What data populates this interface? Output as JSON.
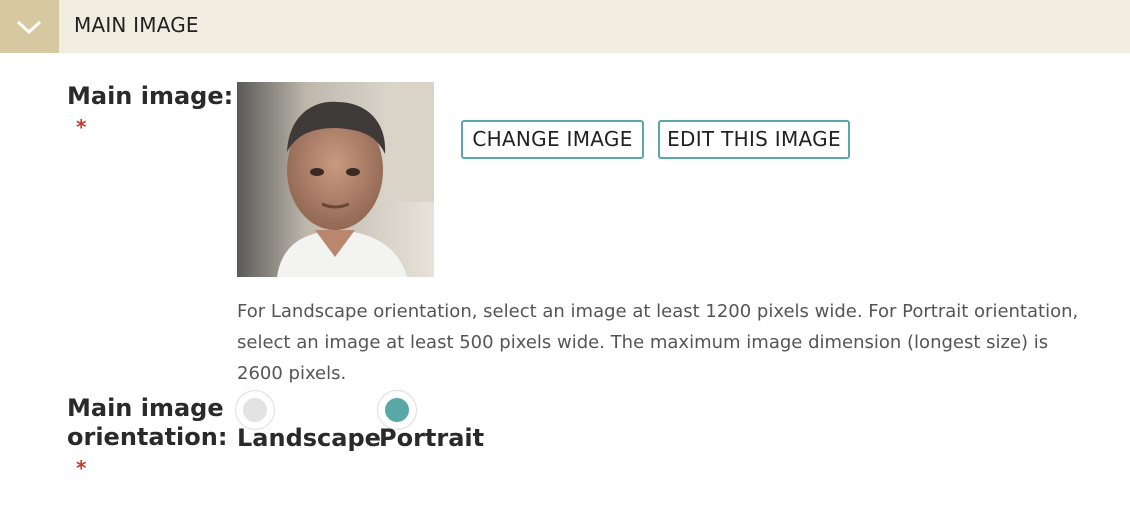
{
  "header": {
    "title": "MAIN IMAGE",
    "toggle_icon": "chevron-down-icon",
    "accent": "#d6c9a2",
    "background": "#f1ede1"
  },
  "main_image": {
    "label": "Main image:",
    "required_mark": "*",
    "change_button": "CHANGE IMAGE",
    "edit_button": "EDIT THIS IMAGE",
    "help_text": "For Landscape orientation, select an image at least 1200 pixels wide. For Portrait orientation, select an image at least 500 pixels wide. The maximum image dimension (longest size) is 2600 pixels."
  },
  "orientation": {
    "label_line1": "Main image",
    "label_line2": "orientation:",
    "required_mark": "*",
    "options": [
      {
        "label": "Landscape",
        "selected": false
      },
      {
        "label": "Portrait",
        "selected": true
      }
    ]
  },
  "colors": {
    "accent": "#5aa8a5",
    "required": "#c0392b"
  }
}
